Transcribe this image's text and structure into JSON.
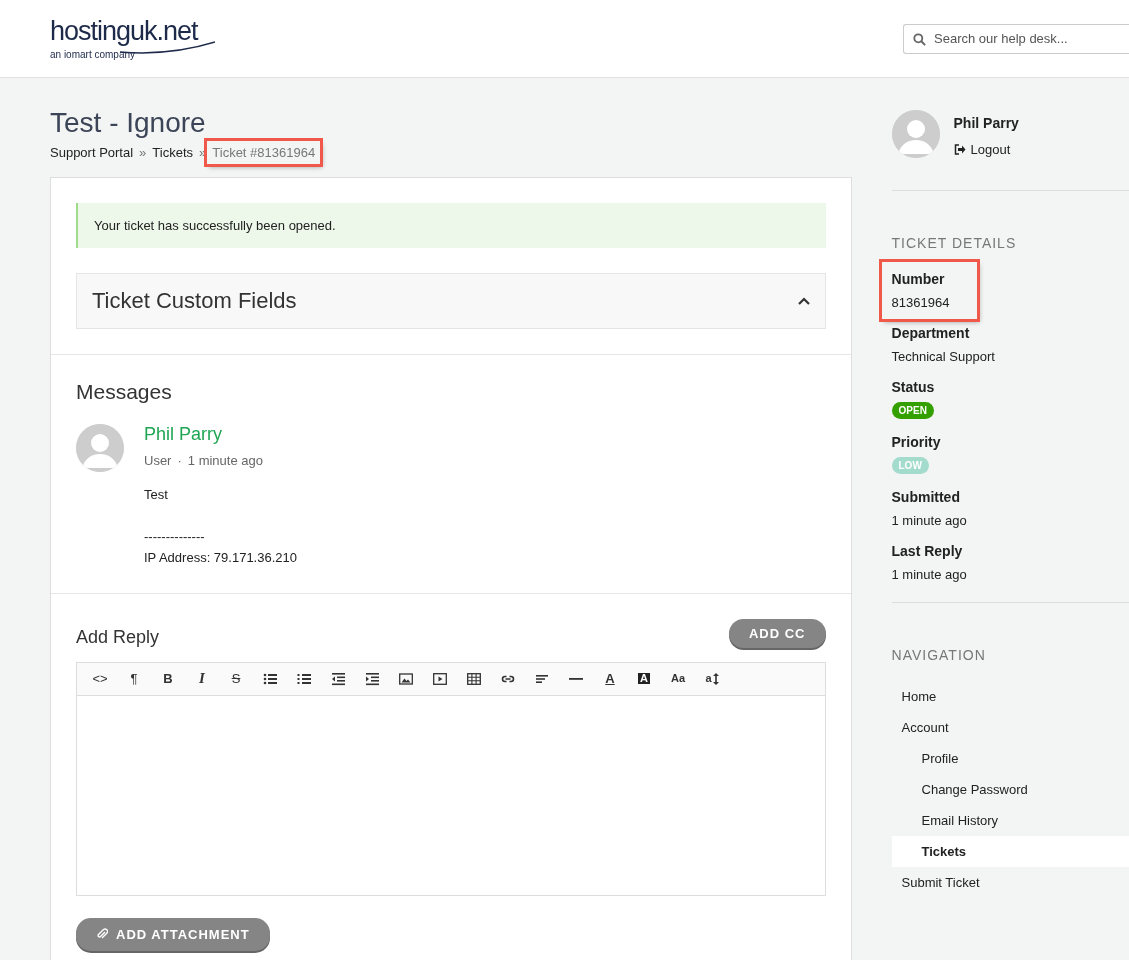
{
  "header": {
    "logo": {
      "name": "hostinguk.net",
      "tagline": "an iomart company"
    },
    "search": {
      "placeholder": "Search our help desk..."
    }
  },
  "page": {
    "title": "Test - Ignore",
    "breadcrumb": [
      {
        "label": "Support Portal",
        "highlighted": false
      },
      {
        "label": "Tickets",
        "highlighted": false
      },
      {
        "label": "Ticket #81361964",
        "highlighted": true
      }
    ],
    "separator": "»"
  },
  "alert": "Your ticket has successfully been opened.",
  "custom_fields": {
    "title": "Ticket Custom Fields"
  },
  "messages": {
    "title": "Messages",
    "items": [
      {
        "author": "Phil Parry",
        "role": "User",
        "separator": "·",
        "time": "1 minute ago",
        "paragraphs": [
          [
            "Test"
          ],
          [
            "--------------",
            "IP Address: 79.171.36.210"
          ]
        ]
      }
    ]
  },
  "reply": {
    "title": "Add Reply",
    "add_cc": "ADD CC",
    "toolbar": [
      {
        "kind": "code",
        "label": "<>"
      },
      {
        "kind": "paragraph",
        "label": "¶"
      },
      {
        "kind": "bold",
        "label": "B"
      },
      {
        "kind": "italic",
        "label": "I"
      },
      {
        "kind": "strike",
        "label": "S"
      },
      {
        "kind": "ul"
      },
      {
        "kind": "ol"
      },
      {
        "kind": "outdent"
      },
      {
        "kind": "indent"
      },
      {
        "kind": "image"
      },
      {
        "kind": "video"
      },
      {
        "kind": "table"
      },
      {
        "kind": "link"
      },
      {
        "kind": "align"
      },
      {
        "kind": "rule"
      },
      {
        "kind": "color",
        "label": "A"
      },
      {
        "kind": "bgcolor",
        "label": "A"
      },
      {
        "kind": "fontsize",
        "label": "Aa"
      },
      {
        "kind": "lineheight",
        "label": "a"
      }
    ],
    "attachment": "ADD ATTACHMENT"
  },
  "sidebar": {
    "user": {
      "name": "Phil Parry",
      "logout": "Logout"
    },
    "details_title": "TICKET DETAILS",
    "details": [
      {
        "label": "Number",
        "kind": "text",
        "value": "81361964",
        "highlighted": true
      },
      {
        "label": "Department",
        "kind": "text",
        "value": "Technical Support",
        "highlighted": false
      },
      {
        "label": "Status",
        "kind": "badge",
        "value": "OPEN",
        "color": "#33a000",
        "highlighted": false
      },
      {
        "label": "Priority",
        "kind": "badge",
        "value": "LOW",
        "color": "#a3dccd",
        "highlighted": false
      },
      {
        "label": "Submitted",
        "kind": "text",
        "value": "1 minute ago",
        "highlighted": false
      },
      {
        "label": "Last Reply",
        "kind": "text",
        "value": "1 minute ago",
        "highlighted": false
      }
    ],
    "nav_title": "NAVIGATION",
    "nav": [
      {
        "label": "Home",
        "selected": false
      },
      {
        "label": "Account",
        "selected": false,
        "children": [
          {
            "label": "Profile",
            "selected": false
          },
          {
            "label": "Change Password",
            "selected": false
          },
          {
            "label": "Email History",
            "selected": false
          },
          {
            "label": "Tickets",
            "selected": true
          }
        ]
      },
      {
        "label": "Submit Ticket",
        "selected": false
      }
    ]
  }
}
